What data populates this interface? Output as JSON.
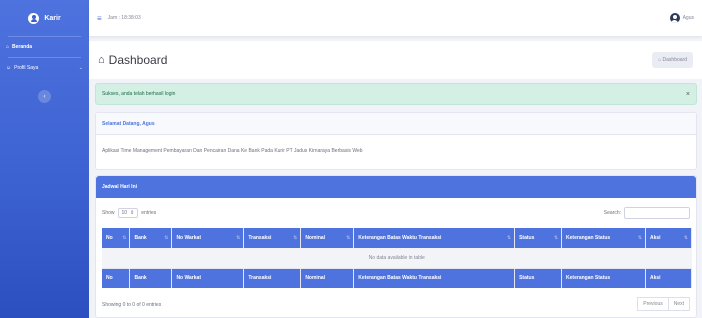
{
  "sidebar": {
    "brand": "Karir",
    "items": [
      {
        "label": "Beranda"
      },
      {
        "label": "Profil Saya"
      }
    ],
    "toggle_icon": "chevron-left-icon"
  },
  "topbar": {
    "time": "Jam : 18:38:03",
    "user_name": "Agus"
  },
  "page": {
    "title": "Dashboard",
    "breadcrumb": "Dashboard"
  },
  "alert": {
    "message": "Sukses, anda telah berhasil login",
    "close": "×"
  },
  "welcome": {
    "title": "Selamat Datang, Agus",
    "body": "Aplikasi Time Management Pembayaran Dan Pencairan Dana Ke Bank Pada Kurir PT Jadus Kirnaraya Berbasis Web"
  },
  "schedule": {
    "title": "Jadwal Hari Ini",
    "show_label": "Show",
    "entries_value": "10",
    "entries_label": "entries",
    "search_label": "Search:",
    "columns": [
      "No",
      "Bank",
      "No Warkat",
      "Transaksi",
      "Nominal",
      "Keterangan Batas Waktu Transaksi",
      "Status",
      "Keterangan Status",
      "Aksi"
    ],
    "empty_message": "No data available in table",
    "info": "Showing 0 to 0 of 0 entries",
    "prev": "Previous",
    "next": "Next"
  },
  "colors": {
    "primary": "#4e73df",
    "success_bg": "#d4efe4"
  }
}
